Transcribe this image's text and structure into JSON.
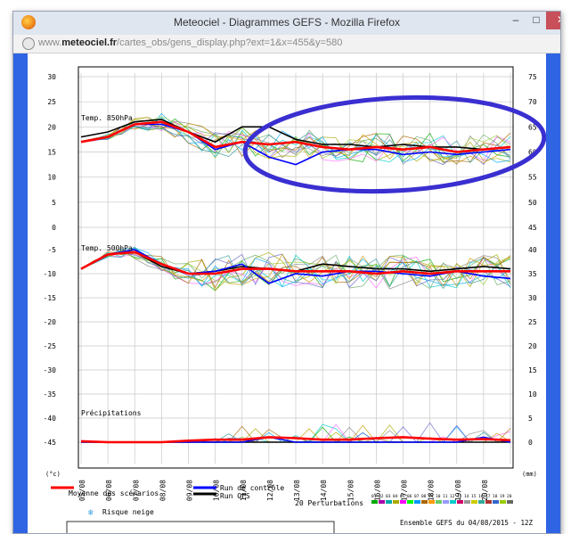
{
  "window": {
    "title": "Meteociel - Diagrammes GEFS - Mozilla Firefox",
    "minimize_glyph": "–",
    "maximize_glyph": "□",
    "close_glyph": "✕",
    "app_icon": "firefox-icon"
  },
  "address_bar": {
    "url_prefix": "www.",
    "url_domain": "meteociel.fr",
    "url_path": "/cartes_obs/gens_display.php?ext=1&x=455&y=580",
    "icon": "globe-icon"
  },
  "colors": {
    "page_background": "#2f64e3",
    "mean": "#ff0000",
    "control": "#0000ff",
    "gfs": "#000000",
    "annotation": "#3a2fd0"
  },
  "chart_data": {
    "type": "line",
    "dates": [
      "05/08",
      "06/08",
      "07/08",
      "08/08",
      "09/08",
      "10/08",
      "11/08",
      "12/08",
      "13/08",
      "14/08",
      "15/08",
      "16/08",
      "17/08",
      "18/08",
      "19/08",
      "20/08"
    ],
    "panels": [
      {
        "title": "Temp. 850hPa",
        "left_ticks": [
          "30",
          "25",
          "20",
          "15",
          "10",
          "5",
          "0"
        ],
        "right_ticks": [
          "75",
          "70",
          "65",
          "60",
          "55",
          "50",
          "45"
        ],
        "ylim": [
          0,
          30
        ],
        "x": [
          0,
          1,
          2,
          3,
          4,
          5,
          6,
          7,
          8,
          9,
          10,
          11,
          12,
          13,
          14,
          15,
          16
        ],
        "series": [
          {
            "name": "Moyenne des scénarios",
            "values": [
              17,
              18,
              20.5,
              21,
              19,
              16,
              17,
              16.5,
              17,
              16,
              15.5,
              16,
              15.5,
              16,
              15,
              15.5,
              16
            ]
          },
          {
            "name": "Run de contrôle",
            "values": [
              17,
              18,
              20.5,
              20.5,
              19,
              15.5,
              17,
              14,
              12.5,
              15,
              15.5,
              15.5,
              14.5,
              15,
              14.5,
              15,
              15.5
            ]
          },
          {
            "name": "Run GFS",
            "values": [
              18,
              19,
              21,
              21.5,
              19,
              17,
              20,
              20,
              17.5,
              16.5,
              16.5,
              16,
              16.5,
              16,
              16,
              15.5,
              16
            ]
          }
        ]
      },
      {
        "title": "Temp. 500hPa",
        "left_ticks": [
          "-5",
          "-10",
          "-15",
          "-20",
          "-25",
          "-30",
          "-35",
          "-40",
          "-45"
        ],
        "right_ticks": [
          "40",
          "35",
          "30",
          "25",
          "20",
          "15",
          "10",
          "5",
          "0"
        ],
        "ylim": [
          -45,
          -5
        ],
        "x": [
          0,
          1,
          2,
          3,
          4,
          5,
          6,
          7,
          8,
          9,
          10,
          11,
          12,
          13,
          14,
          15,
          16
        ],
        "series": [
          {
            "name": "Moyenne des scénarios",
            "values": [
              -9,
              -6,
              -5.5,
              -8,
              -10,
              -10,
              -9,
              -9,
              -9.5,
              -9.5,
              -9.5,
              -10,
              -9.5,
              -10,
              -9.5,
              -9.5,
              -9.5
            ]
          },
          {
            "name": "Run de contrôle",
            "values": [
              -9,
              -6,
              -5,
              -8,
              -10,
              -9.5,
              -8,
              -12,
              -10,
              -10.5,
              -9.5,
              -9.5,
              -10,
              -10.5,
              -9.5,
              -10.5,
              -11
            ]
          },
          {
            "name": "Run GFS",
            "values": [
              -9,
              -6,
              -5.5,
              -8.5,
              -10,
              -9.5,
              -8.5,
              -9,
              -9.5,
              -8,
              -8.5,
              -9,
              -9,
              -9.5,
              -9,
              -8.5,
              -9
            ]
          }
        ]
      },
      {
        "title": "Précipitations",
        "ylim": [
          0,
          10
        ],
        "x": [
          0,
          1,
          2,
          3,
          4,
          5,
          6,
          7,
          8,
          9,
          10,
          11,
          12,
          13,
          14,
          15,
          16
        ],
        "series": [
          {
            "name": "Moyenne des scénarios",
            "values": [
              0.2,
              0,
              0,
              0,
              0.3,
              0.5,
              0.5,
              1,
              0.8,
              0.5,
              0.5,
              0.8,
              1,
              0.7,
              0.5,
              0.6,
              0.4
            ]
          },
          {
            "name": "Run de contrôle",
            "values": [
              0,
              0,
              0,
              0,
              0,
              0,
              0,
              1,
              0,
              0,
              0,
              0,
              0,
              0,
              0,
              1,
              0
            ]
          },
          {
            "name": "Run GFS",
            "values": [
              0,
              0,
              0,
              0,
              0,
              0,
              0,
              0,
              0,
              0,
              0,
              0,
              0,
              0,
              0,
              0,
              0
            ]
          }
        ]
      }
    ],
    "left_unit": "(°c)",
    "right_unit": "(mm)",
    "legend": {
      "mean": "Moyenne des scénarios",
      "control": "Run de contrôle",
      "gfs": "Run GFS",
      "perturbations": "20 Perturbations",
      "perturbation_ids": [
        "01",
        "02",
        "03",
        "04",
        "05",
        "06",
        "07",
        "08",
        "09",
        "10",
        "11",
        "12",
        "13",
        "14",
        "15",
        "16",
        "17",
        "18",
        "19",
        "20"
      ],
      "snow": "Risque neige",
      "footer_partial": "Ensemble GEFS du 04/08/2015 - 12Z"
    }
  }
}
